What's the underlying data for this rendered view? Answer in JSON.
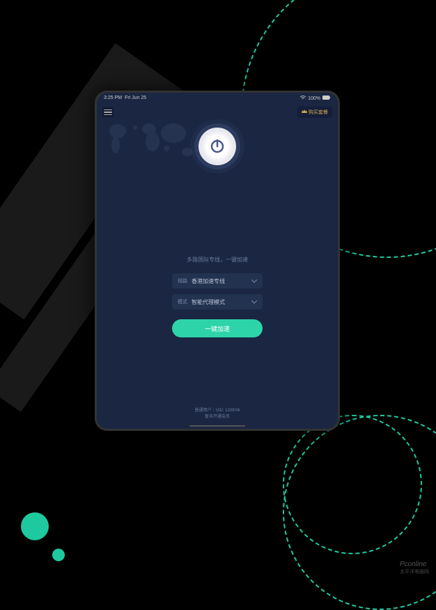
{
  "status_bar": {
    "time": "3:25 PM",
    "date": "Fri Jun 25",
    "battery": "100%"
  },
  "top_bar": {
    "vip_label": "购买套餐"
  },
  "tagline": "多路国际专线，一键加速",
  "selectors": {
    "line": {
      "label": "线路",
      "value": "香港加速专线"
    },
    "mode": {
      "label": "模式",
      "value": "智能代理模式"
    }
  },
  "accelerate_label": "一键加速",
  "footer": {
    "user_info": "普通用户｜UID: 120804i",
    "member_status": "暂未开通会员"
  },
  "watermark": {
    "brand": "Pconline",
    "sub": "太平洋电脑网"
  },
  "colors": {
    "accent": "#2dd4aa",
    "bg": "#1a2642"
  }
}
